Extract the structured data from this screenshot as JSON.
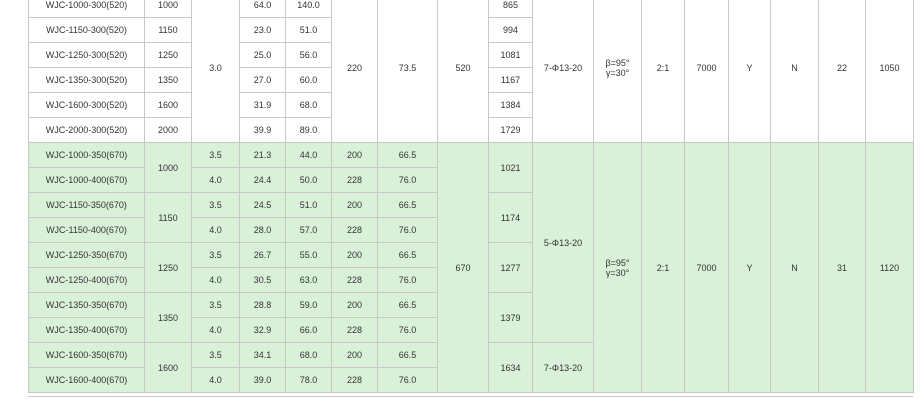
{
  "group1": {
    "rows": [
      {
        "model": "WJC-1000-300(520)",
        "size": "1000",
        "c1": "64.0",
        "c2": "140.0",
        "weight": "865"
      },
      {
        "model": "WJC-1150-300(520)",
        "size": "1150",
        "c1": "23.0",
        "c2": "51.0",
        "weight": "994"
      },
      {
        "model": "WJC-1250-300(520)",
        "size": "1250",
        "c1": "25.0",
        "c2": "56.0",
        "weight": "1081"
      },
      {
        "model": "WJC-1350-300(520)",
        "size": "1350",
        "c1": "27.0",
        "c2": "60.0",
        "weight": "1167"
      },
      {
        "model": "WJC-1600-300(520)",
        "size": "1600",
        "c1": "31.9",
        "c2": "68.0",
        "weight": "1384"
      },
      {
        "model": "WJC-2000-300(520)",
        "size": "2000",
        "c1": "39.9",
        "c2": "89.0",
        "weight": "1729"
      }
    ],
    "thickness": "3.0",
    "height": "220",
    "ratio_val": "73.5",
    "width": "520",
    "holes": "7-Φ13-20",
    "angle_beta": "β=95°",
    "angle_gamma": "γ=30°",
    "ratio": "2:1",
    "speed": "7000",
    "opt_y": "Y",
    "opt_n": "N",
    "qty": "22",
    "total": "1050"
  },
  "group2": {
    "rows": [
      {
        "model": "WJC-1000-350(670)",
        "t": "3.5",
        "c1": "21.3",
        "c2": "44.0",
        "h": "200",
        "v": "66.5"
      },
      {
        "model": "WJC-1000-400(670)",
        "t": "4.0",
        "c1": "24.4",
        "c2": "50.0",
        "h": "228",
        "v": "76.0"
      },
      {
        "model": "WJC-1150-350(670)",
        "t": "3.5",
        "c1": "24.5",
        "c2": "51.0",
        "h": "200",
        "v": "66.5"
      },
      {
        "model": "WJC-1150-400(670)",
        "t": "4.0",
        "c1": "28.0",
        "c2": "57.0",
        "h": "228",
        "v": "76.0"
      },
      {
        "model": "WJC-1250-350(670)",
        "t": "3.5",
        "c1": "26.7",
        "c2": "55.0",
        "h": "200",
        "v": "66.5"
      },
      {
        "model": "WJC-1250-400(670)",
        "t": "4.0",
        "c1": "30.5",
        "c2": "63.0",
        "h": "228",
        "v": "76.0"
      },
      {
        "model": "WJC-1350-350(670)",
        "t": "3.5",
        "c1": "28.8",
        "c2": "59.0",
        "h": "200",
        "v": "66.5"
      },
      {
        "model": "WJC-1350-400(670)",
        "t": "4.0",
        "c1": "32.9",
        "c2": "66.0",
        "h": "228",
        "v": "76.0"
      },
      {
        "model": "WJC-1600-350(670)",
        "t": "3.5",
        "c1": "34.1",
        "c2": "68.0",
        "h": "200",
        "v": "66.5"
      },
      {
        "model": "WJC-1600-400(670)",
        "t": "4.0",
        "c1": "39.0",
        "c2": "78.0",
        "h": "228",
        "v": "76.0"
      }
    ],
    "sizes": [
      "1000",
      "1150",
      "1250",
      "1350",
      "1600"
    ],
    "weights": [
      "1021",
      "1174",
      "1277",
      "1379",
      "1634"
    ],
    "width": "670",
    "holes_main": "5-Φ13-20",
    "holes_last": "7-Φ13-20",
    "angle_beta": "β=95°",
    "angle_gamma": "γ=30°",
    "ratio": "2:1",
    "speed": "7000",
    "opt_y": "Y",
    "opt_n": "N",
    "qty": "31",
    "total": "1120"
  }
}
